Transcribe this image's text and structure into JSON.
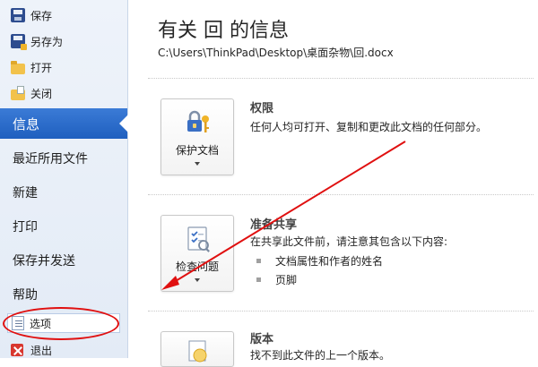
{
  "nav": {
    "commands": {
      "save": "保存",
      "save_as": "另存为",
      "open": "打开",
      "close": "关闭"
    },
    "tabs": {
      "info": "信息",
      "recent": "最近所用文件",
      "new": "新建",
      "print": "打印",
      "save_send": "保存并发送",
      "help": "帮助"
    },
    "options": "选项",
    "exit": "退出"
  },
  "main": {
    "title": "有关 回 的信息",
    "path": "C:\\Users\\ThinkPad\\Desktop\\桌面杂物\\回.docx",
    "permissions": {
      "button": "保护文档",
      "title": "权限",
      "desc": "任何人均可打开、复制和更改此文档的任何部分。"
    },
    "prepare": {
      "button": "检查问题",
      "title": "准备共享",
      "desc": "在共享此文件前，请注意其包含以下内容:",
      "bullets": [
        "文档属性和作者的姓名",
        "页脚"
      ]
    },
    "versions": {
      "title": "版本",
      "desc": "找不到此文件的上一个版本。"
    }
  },
  "colors": {
    "accent": "#1f5fbf",
    "annotation": "#e01010"
  }
}
